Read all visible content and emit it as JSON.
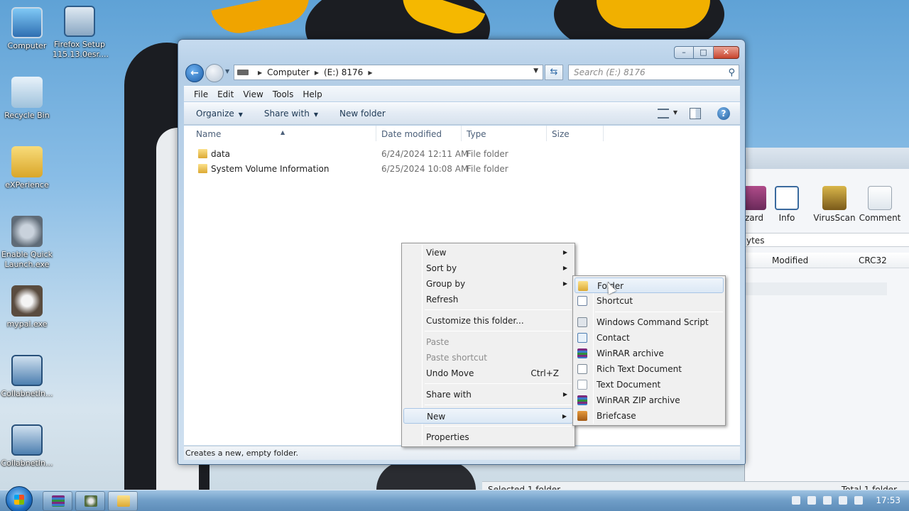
{
  "desktop": {
    "icons": [
      {
        "label": "Computer",
        "icon": "computer-icon"
      },
      {
        "label": "Firefox Setup 115.13.0esr....",
        "icon": "setup-icon"
      },
      {
        "label": "Recycle Bin",
        "icon": "recycle-bin-icon"
      },
      {
        "label": "eXPerience",
        "icon": "folder-icon"
      },
      {
        "label": "Enable Quick Launch.exe",
        "icon": "quick-launch-icon"
      },
      {
        "label": "mypal.exe",
        "icon": "raccoon-icon"
      },
      {
        "label": "CollabnetIn...",
        "icon": "network-icon"
      },
      {
        "label": "CollabnetIn...",
        "icon": "network-icon"
      }
    ]
  },
  "back_window": {
    "tools": [
      "zard",
      "Info",
      "VirusScan",
      "Comment"
    ],
    "address_fragment": "ytes",
    "columns": [
      "Modified",
      "CRC32"
    ],
    "status_left": "Selected 1 folder",
    "status_right": "Total 1 folder"
  },
  "explorer": {
    "breadcrumb": [
      "Computer",
      "(E:) 8176"
    ],
    "search_placeholder": "Search (E:) 8176",
    "menu": [
      "File",
      "Edit",
      "View",
      "Tools",
      "Help"
    ],
    "commands": [
      "Organize",
      "Share with",
      "New folder"
    ],
    "columns": [
      "Name",
      "Date modified",
      "Type",
      "Size"
    ],
    "files": [
      {
        "name": "data",
        "date": "6/24/2024 12:11 AM",
        "type": "File folder"
      },
      {
        "name": "System Volume Information",
        "date": "6/25/2024 10:08 AM",
        "type": "File folder"
      }
    ],
    "status": "Creates a new, empty folder."
  },
  "context_menu": {
    "view": "View",
    "sort_by": "Sort by",
    "group_by": "Group by",
    "refresh": "Refresh",
    "customize": "Customize this folder...",
    "paste": "Paste",
    "paste_shortcut": "Paste shortcut",
    "undo_move": "Undo Move",
    "undo_key": "Ctrl+Z",
    "share_with": "Share with",
    "new": "New",
    "properties": "Properties"
  },
  "new_submenu": {
    "items": [
      {
        "label": "Folder",
        "icon": "folder-icon"
      },
      {
        "label": "Shortcut",
        "icon": "shortcut-icon"
      },
      {
        "label": "Windows Command Script",
        "icon": "command-script-icon"
      },
      {
        "label": "Contact",
        "icon": "contact-icon"
      },
      {
        "label": "WinRAR archive",
        "icon": "winrar-icon"
      },
      {
        "label": "Rich Text Document",
        "icon": "rich-text-icon"
      },
      {
        "label": "Text Document",
        "icon": "text-document-icon"
      },
      {
        "label": "WinRAR ZIP archive",
        "icon": "winrar-zip-icon"
      },
      {
        "label": "Briefcase",
        "icon": "briefcase-icon"
      }
    ]
  },
  "taskbar": {
    "clock": "17:53"
  }
}
